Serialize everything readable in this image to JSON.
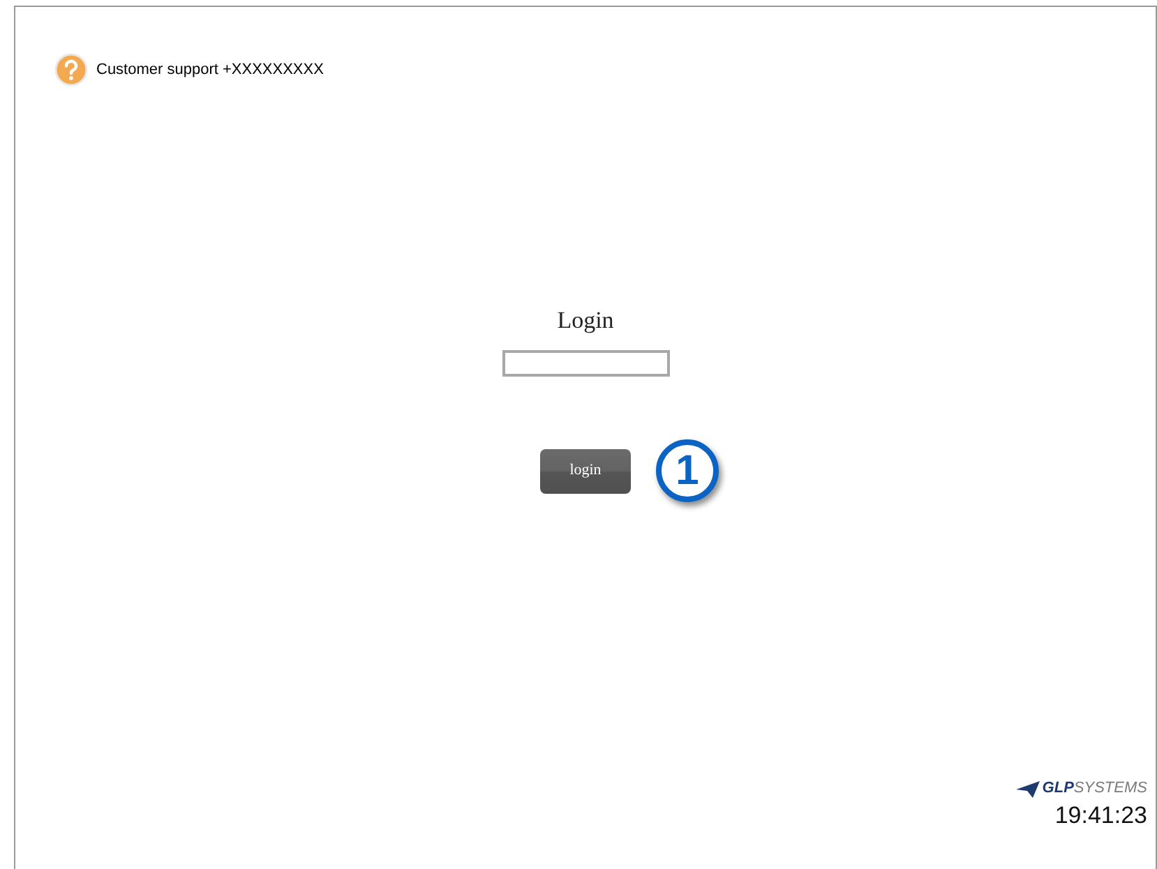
{
  "header": {
    "support_text": "Customer support +XXXXXXXXX"
  },
  "login_form": {
    "title": "Login",
    "button": "login",
    "callout": "1"
  },
  "footer": {
    "logo": "**GLP**SYSTEMS",
    "clock": "19:41:23"
  }
}
